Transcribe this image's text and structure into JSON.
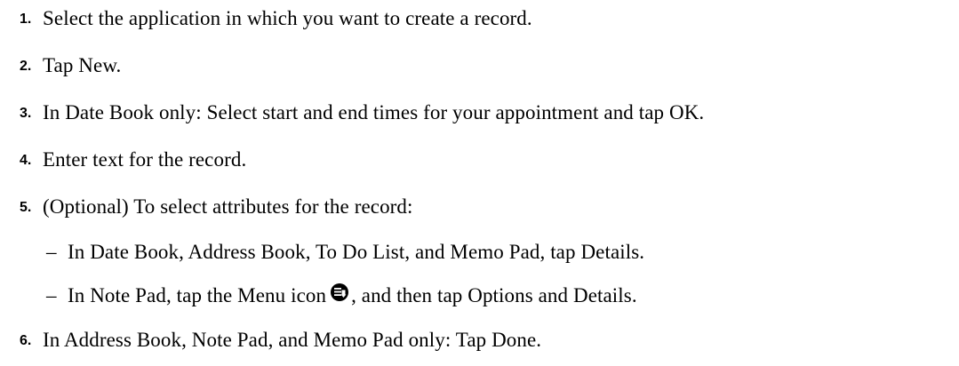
{
  "steps": [
    {
      "number": "1.",
      "text": "Select the application in which you want to create a record."
    },
    {
      "number": "2.",
      "text": "Tap New."
    },
    {
      "number": "3.",
      "text": "In Date Book only: Select start and end times for your appointment and tap OK."
    },
    {
      "number": "4.",
      "text": "Enter text for the record."
    },
    {
      "number": "5.",
      "text": "(Optional) To select attributes for the record:"
    },
    {
      "number": "6.",
      "text": "In Address Book, Note Pad, and Memo Pad only: Tap Done."
    }
  ],
  "substeps": [
    {
      "marker": "–",
      "text": "In Date Book, Address Book, To Do List, and Memo Pad, tap Details."
    },
    {
      "marker": "–",
      "text_before": "In Note Pad, tap the Menu icon",
      "icon": "menu-icon",
      "text_after": ", and then tap Options and Details."
    }
  ]
}
